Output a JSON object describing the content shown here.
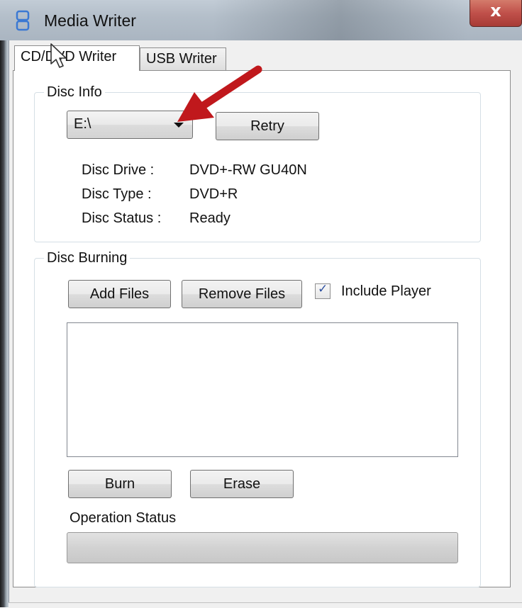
{
  "window": {
    "title": "Media Writer",
    "close_glyph": "x"
  },
  "tabs": [
    {
      "label": "CD/DVD Writer",
      "selected": true
    },
    {
      "label": "USB Writer",
      "selected": false
    }
  ],
  "disc_info": {
    "legend": "Disc Info",
    "drive_select": {
      "value": "E:\\"
    },
    "retry_label": "Retry",
    "rows": [
      {
        "label": "Disc Drive :",
        "value": "DVD+-RW GU40N"
      },
      {
        "label": "Disc Type :",
        "value": "DVD+R"
      },
      {
        "label": "Disc Status :",
        "value": "Ready"
      }
    ]
  },
  "disc_burning": {
    "legend": "Disc Burning",
    "add_files_label": "Add Files",
    "remove_files_label": "Remove Files",
    "include_player": {
      "label": "Include Player",
      "checked": true,
      "check_glyph": "✓"
    },
    "burn_label": "Burn",
    "erase_label": "Erase",
    "operation_status_label": "Operation Status",
    "progress_fraction": 0
  },
  "colors": {
    "annotation_arrow": "#c0181c",
    "close_button": "#c0504a"
  }
}
